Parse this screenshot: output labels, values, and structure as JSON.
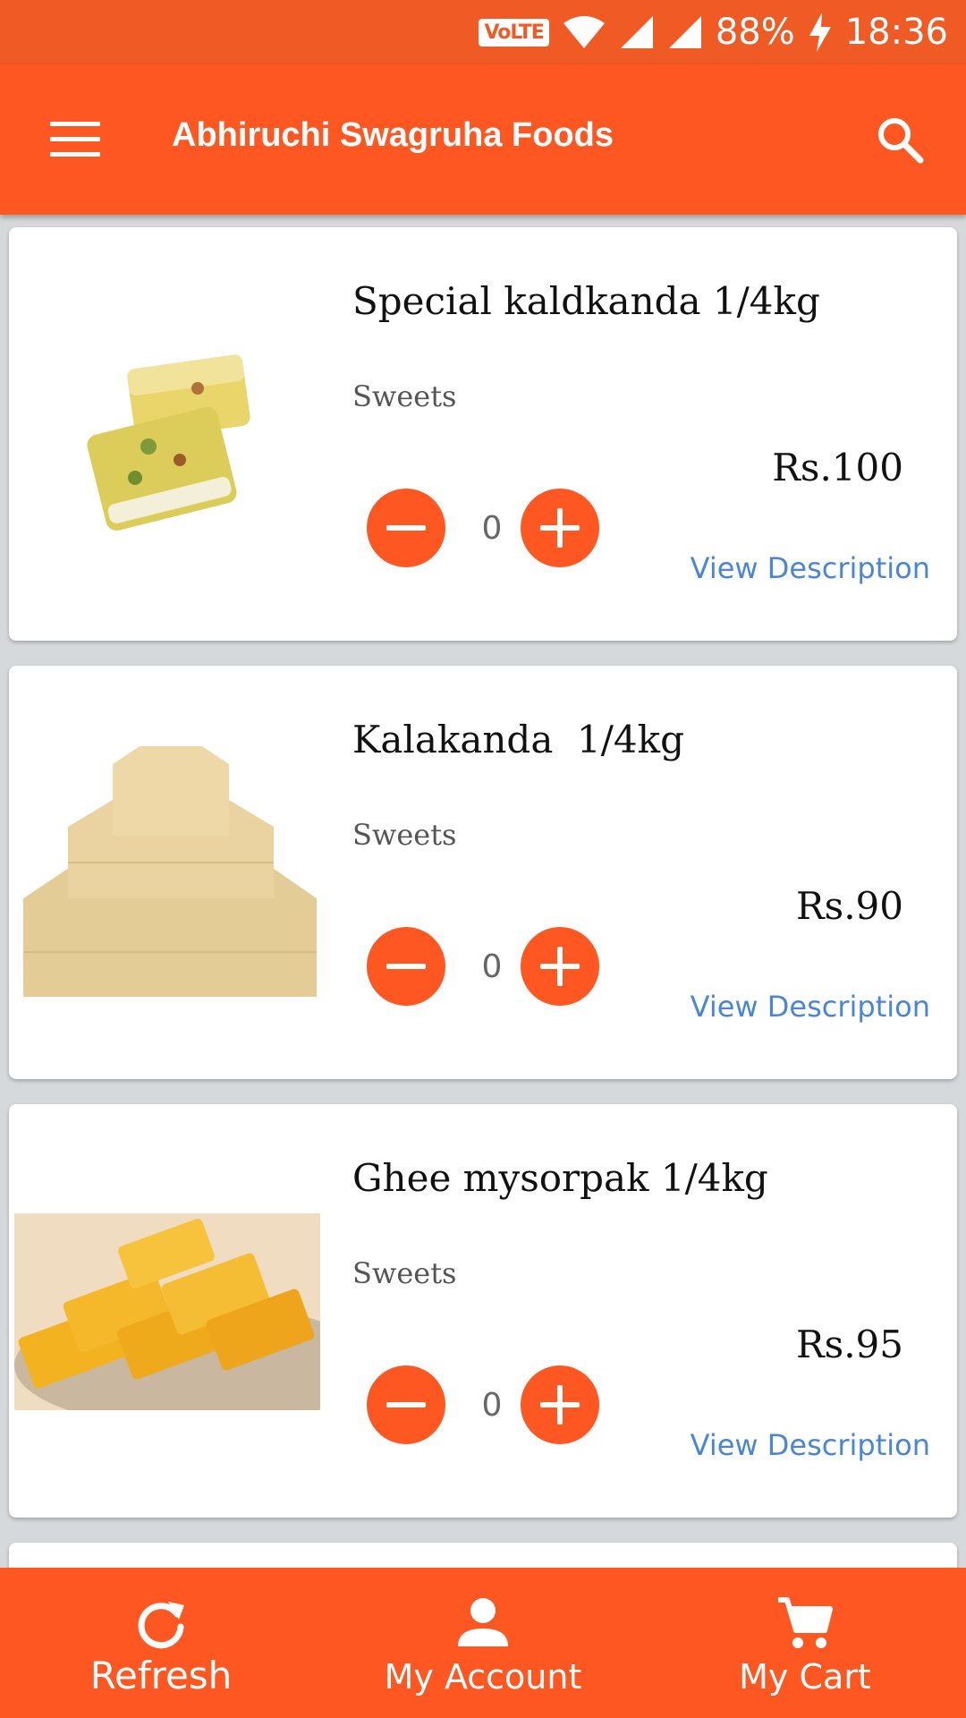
{
  "status_bar": {
    "network": "VoLTE",
    "battery": "88%",
    "time": "18:36"
  },
  "app_bar": {
    "title": "Abhiruchi Swagruha Foods",
    "menu_icon": "menu-icon",
    "search_icon": "search-icon"
  },
  "products": [
    {
      "name": "Special kaldkanda 1/4kg",
      "category": "Sweets",
      "price": "Rs.100",
      "quantity": "0",
      "description_link": "View Description",
      "image": "kalakand-pieces"
    },
    {
      "name": "Kalakanda  1/4kg",
      "category": "Sweets",
      "price": "Rs.90",
      "quantity": "0",
      "description_link": "View Description",
      "image": "kalakand-pyramid"
    },
    {
      "name": "Ghee mysorpak 1/4kg",
      "category": "Sweets",
      "price": "Rs.95",
      "quantity": "0",
      "description_link": "View Description",
      "image": "mysore-pak-plate"
    }
  ],
  "bottom_nav": {
    "refresh": {
      "label": "Refresh",
      "icon": "refresh-icon"
    },
    "account": {
      "label": "My Account",
      "icon": "person-icon"
    },
    "cart": {
      "label": "My Cart",
      "icon": "cart-icon"
    }
  },
  "colors": {
    "primary": "#ff5722",
    "status_bar": "#f05a24",
    "link": "#4a86d8",
    "background": "#d6d9dc"
  }
}
